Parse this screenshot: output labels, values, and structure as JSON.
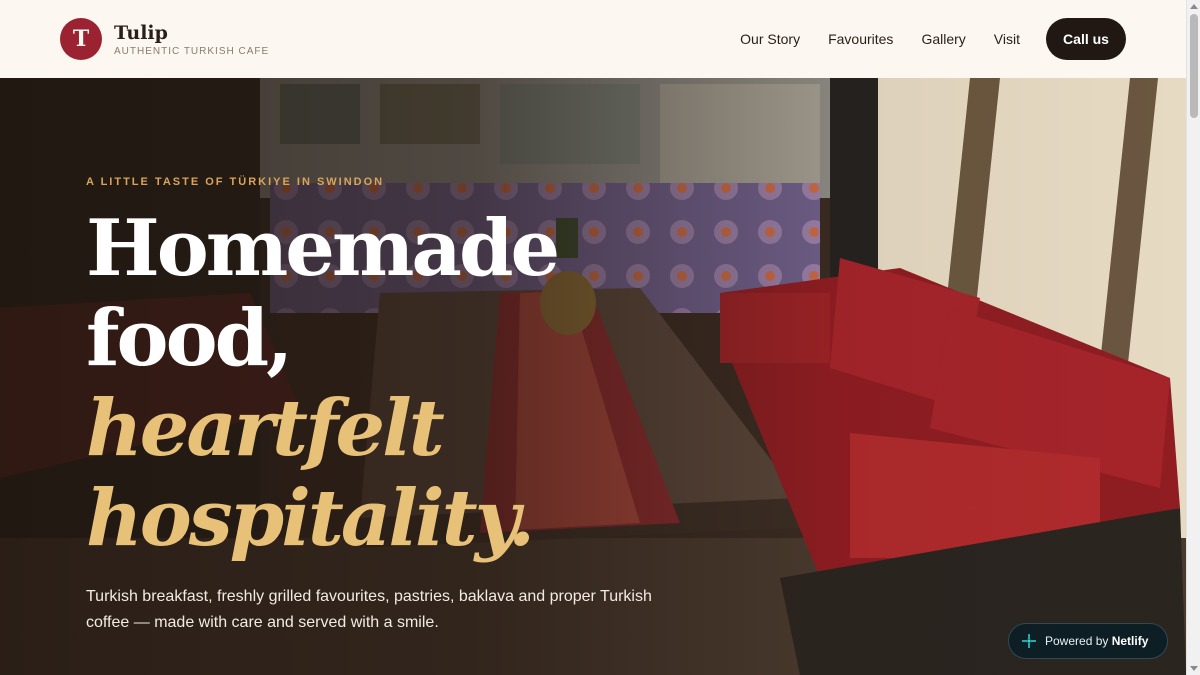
{
  "brand": {
    "logo_letter": "T",
    "name": "Tulip",
    "tagline": "AUTHENTIC TURKISH CAFE"
  },
  "nav": {
    "items": [
      {
        "label": "Our Story"
      },
      {
        "label": "Favourites"
      },
      {
        "label": "Gallery"
      },
      {
        "label": "Visit"
      }
    ],
    "cta_label": "Call us"
  },
  "hero": {
    "eyebrow": "A LITTLE TASTE OF TÜRKIYE IN SWINDON",
    "headline_line1": "Homemade",
    "headline_line2": "food,",
    "headline_accent1": "heartfelt",
    "headline_accent2": "hospitality.",
    "intro": "Turkish breakfast, freshly grilled favourites, pastries, baklava and proper Turkish coffee — made with care and served with a smile.",
    "background_icon": "cafe-interior-photo"
  },
  "netlify_badge": {
    "prefix": "Powered by",
    "brand": "Netlify",
    "icon": "netlify-icon"
  },
  "colors": {
    "brand_red": "#9b2230",
    "header_bg": "#fcf7f0",
    "cta_bg": "#221813",
    "accent_gold": "#e8c178",
    "eyebrow_gold": "#d9a45a"
  }
}
